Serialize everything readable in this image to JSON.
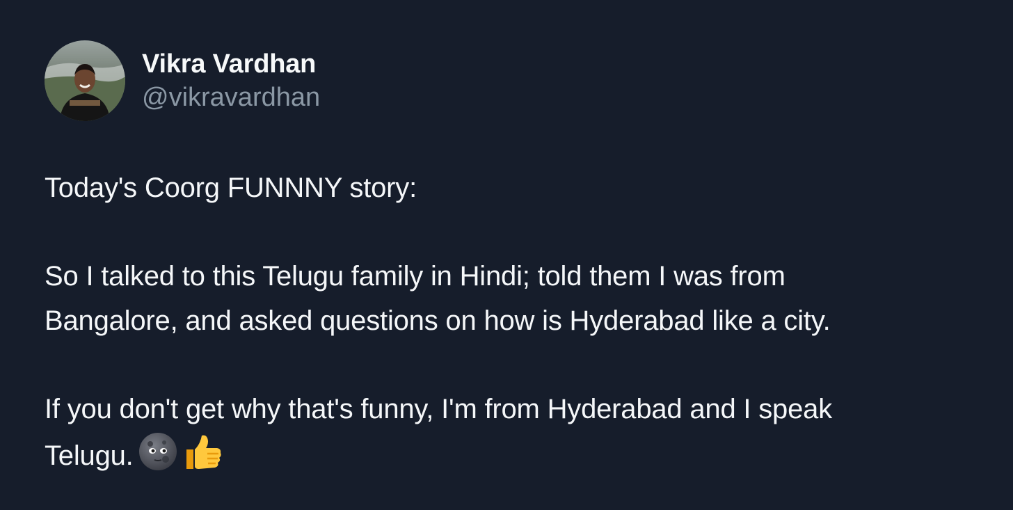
{
  "author": {
    "display_name": "Vikra Vardhan",
    "handle": "@vikravardhan",
    "avatar_icon": "profile-photo"
  },
  "tweet": {
    "line_1": "Today's Coorg FUNNNY story:",
    "para_2_line_1": "So I talked to this Telugu family in Hindi; told them I was from",
    "para_2_line_2": "Bangalore, and asked questions on how is Hyderabad like a city.",
    "para_3_line_1": "If you don't get why that's funny, I'm from Hyderabad and I speak",
    "para_3_line_2": "Telugu.",
    "emojis": [
      "new-moon-face-emoji",
      "thumbs-up-emoji"
    ]
  },
  "colors": {
    "background": "#161d2b",
    "text": "#f5f7f9",
    "handle": "#8b98a5"
  }
}
